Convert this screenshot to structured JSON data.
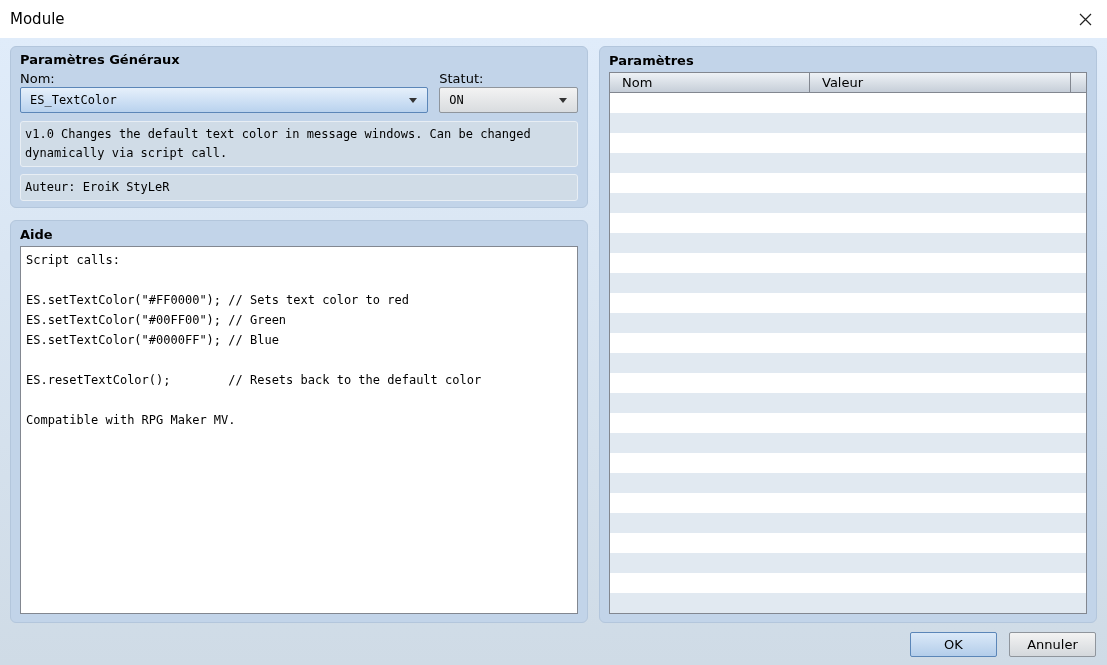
{
  "window": {
    "title": "Module"
  },
  "general": {
    "title": "Paramètres Généraux",
    "name_label": "Nom:",
    "name_value": "ES_TextColor",
    "status_label": "Statut:",
    "status_value": "ON",
    "description": "v1.0 Changes the default text color in message windows. Can be changed dynamically via script call.",
    "author": "Auteur: EroiK StyLeR"
  },
  "help": {
    "title": "Aide",
    "text": "Script calls:\n\nES.setTextColor(\"#FF0000\"); // Sets text color to red\nES.setTextColor(\"#00FF00\"); // Green\nES.setTextColor(\"#0000FF\"); // Blue\n\nES.resetTextColor();        // Resets back to the default color\n\nCompatible with RPG Maker MV."
  },
  "parameters": {
    "title": "Paramètres",
    "columns": [
      "Nom",
      "Valeur"
    ]
  },
  "buttons": [
    {
      "label": "OK",
      "default": true
    },
    {
      "label": "Annuler",
      "default": false
    }
  ]
}
